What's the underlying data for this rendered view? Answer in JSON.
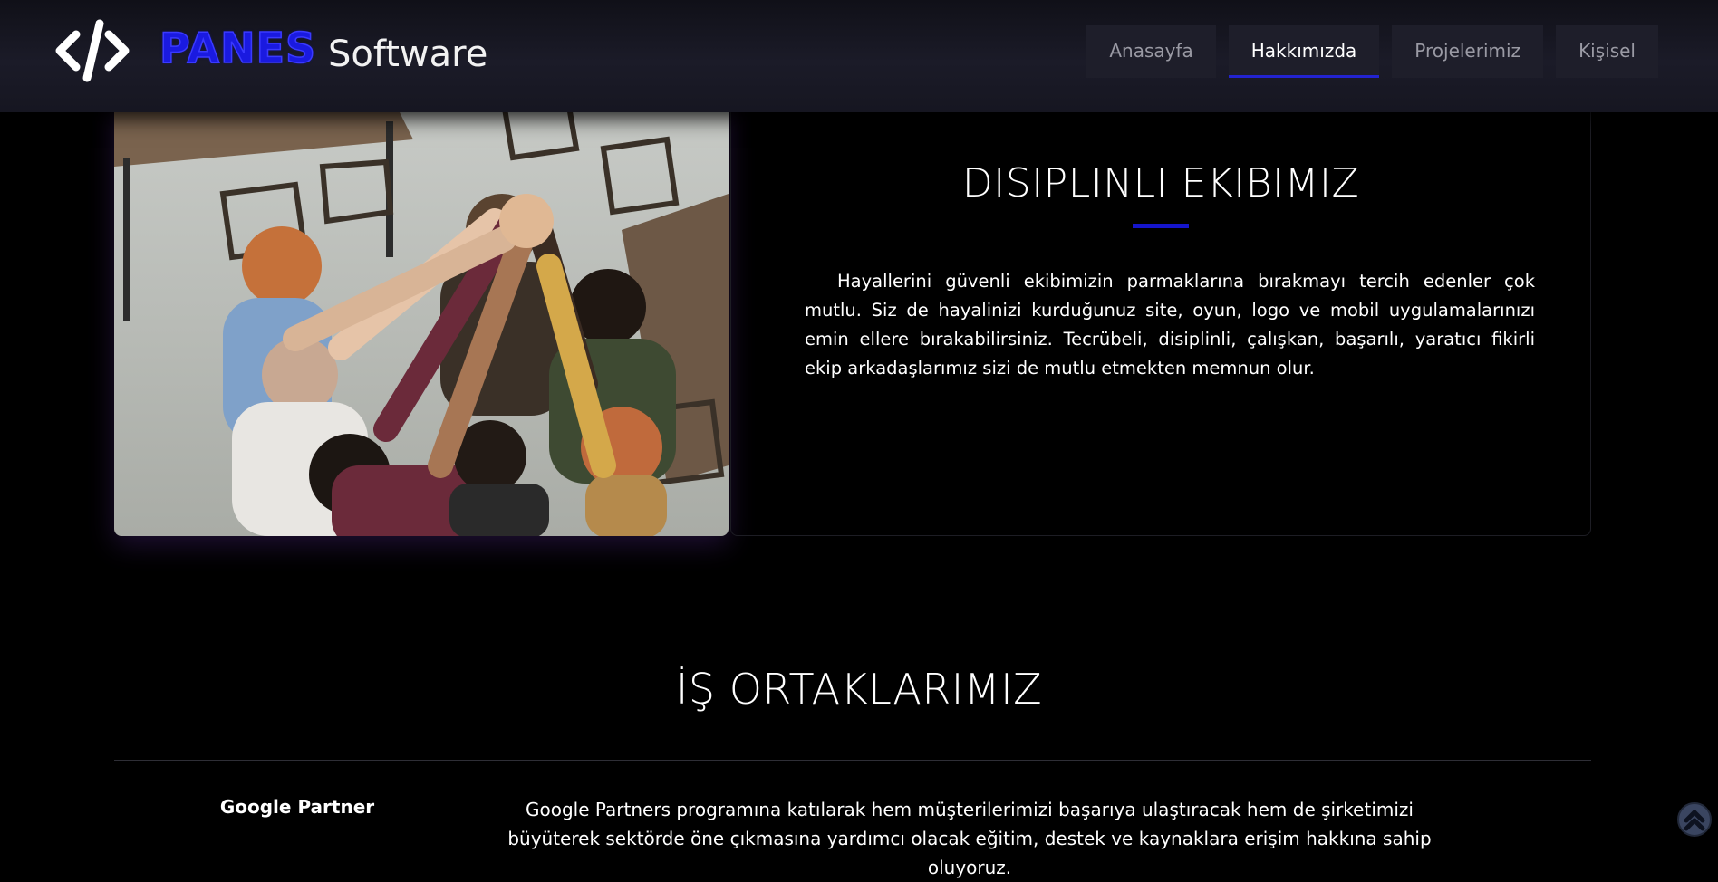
{
  "header": {
    "brand_name": "PANES",
    "brand_suffix": "Software",
    "nav": [
      {
        "label": "Anasayfa",
        "active": false
      },
      {
        "label": "Hakkımızda",
        "active": true
      },
      {
        "label": "Projelerimiz",
        "active": false
      },
      {
        "label": "Kişisel",
        "active": false
      }
    ]
  },
  "team": {
    "title": "DISIPLINLI EKIBIMIZ",
    "text": "Hayallerini güvenli ekibimizin parmaklarına bırakmayı tercih edenler çok mutlu. Siz de hayalinizi kurduğunuz site, oyun, logo ve mobil uygulamalarınızı emin ellere bırakabilirsiniz. Tecrübeli, disiplinli, çalışkan, başarılı, yaratıcı fikirli ekip arkadaşlarımız sizi de mutlu etmekten memnun olur."
  },
  "partners": {
    "title": "İŞ ORTAKLARIMIZ",
    "items": [
      {
        "name": "Google Partner",
        "description": "Google Partners programına katılarak hem müşterilerimizi başarıya ulaştıracak hem de şirketimizi büyüterek sektörde öne çıkmasına yardımcı olacak eğitim, destek ve kaynaklara erişim hakkına sahip oluyoruz."
      }
    ]
  },
  "colors": {
    "accent": "#1515cc",
    "background": "#000000",
    "nav_background": "#1e1e2a"
  }
}
